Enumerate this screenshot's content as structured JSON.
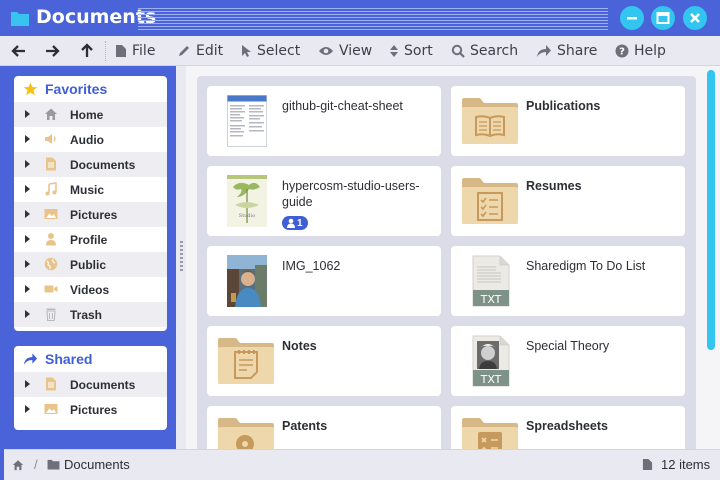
{
  "window": {
    "title": "Documents"
  },
  "toolbar": {
    "items": [
      {
        "label": "File",
        "icon": "file-icon"
      },
      {
        "label": "Edit",
        "icon": "pencil-icon"
      },
      {
        "label": "Select",
        "icon": "cursor-icon"
      },
      {
        "label": "View",
        "icon": "eye-icon"
      },
      {
        "label": "Sort",
        "icon": "sort-icon"
      },
      {
        "label": "Search",
        "icon": "search-icon"
      },
      {
        "label": "Share",
        "icon": "share-icon"
      },
      {
        "label": "Help",
        "icon": "help-icon"
      }
    ]
  },
  "sidebar": {
    "favorites": {
      "title": "Favorites",
      "items": [
        {
          "label": "Home",
          "icon": "home-icon"
        },
        {
          "label": "Audio",
          "icon": "speaker-icon"
        },
        {
          "label": "Documents",
          "icon": "document-icon"
        },
        {
          "label": "Music",
          "icon": "music-note-icon"
        },
        {
          "label": "Pictures",
          "icon": "picture-icon"
        },
        {
          "label": "Profile",
          "icon": "person-icon"
        },
        {
          "label": "Public",
          "icon": "globe-icon"
        },
        {
          "label": "Videos",
          "icon": "video-camera-icon"
        },
        {
          "label": "Trash",
          "icon": "trash-icon"
        }
      ]
    },
    "shared": {
      "title": "Shared",
      "items": [
        {
          "label": "Documents",
          "icon": "document-icon"
        },
        {
          "label": "Pictures",
          "icon": "picture-icon"
        }
      ]
    }
  },
  "files": [
    {
      "name": "github-git-cheat-sheet",
      "kind": "document",
      "bold": false
    },
    {
      "name": "Publications",
      "kind": "folder",
      "icon": "book-icon",
      "bold": true
    },
    {
      "name": "hypercosm-studio-users-guide",
      "kind": "book",
      "bold": false,
      "badge": "1"
    },
    {
      "name": "Resumes",
      "kind": "folder",
      "icon": "checklist-icon",
      "bold": true
    },
    {
      "name": "IMG_1062",
      "kind": "photo",
      "bold": false
    },
    {
      "name": "Sharedigm To Do List",
      "kind": "txt",
      "bold": false,
      "ext": "TXT"
    },
    {
      "name": "Notes",
      "kind": "folder",
      "icon": "notepad-icon",
      "bold": true
    },
    {
      "name": "Special Theory",
      "kind": "txt-image",
      "bold": false,
      "ext": "TXT"
    },
    {
      "name": "Patents",
      "kind": "folder",
      "icon": "lightbulb-icon",
      "bold": true
    },
    {
      "name": "Spreadsheets",
      "kind": "folder",
      "icon": "calculator-icon",
      "bold": true
    }
  ],
  "status": {
    "path": "Documents",
    "count": "12 items"
  },
  "colors": {
    "accent": "#4a63d9",
    "highlight": "#31c5ef",
    "folder": "#e9cf9e"
  }
}
